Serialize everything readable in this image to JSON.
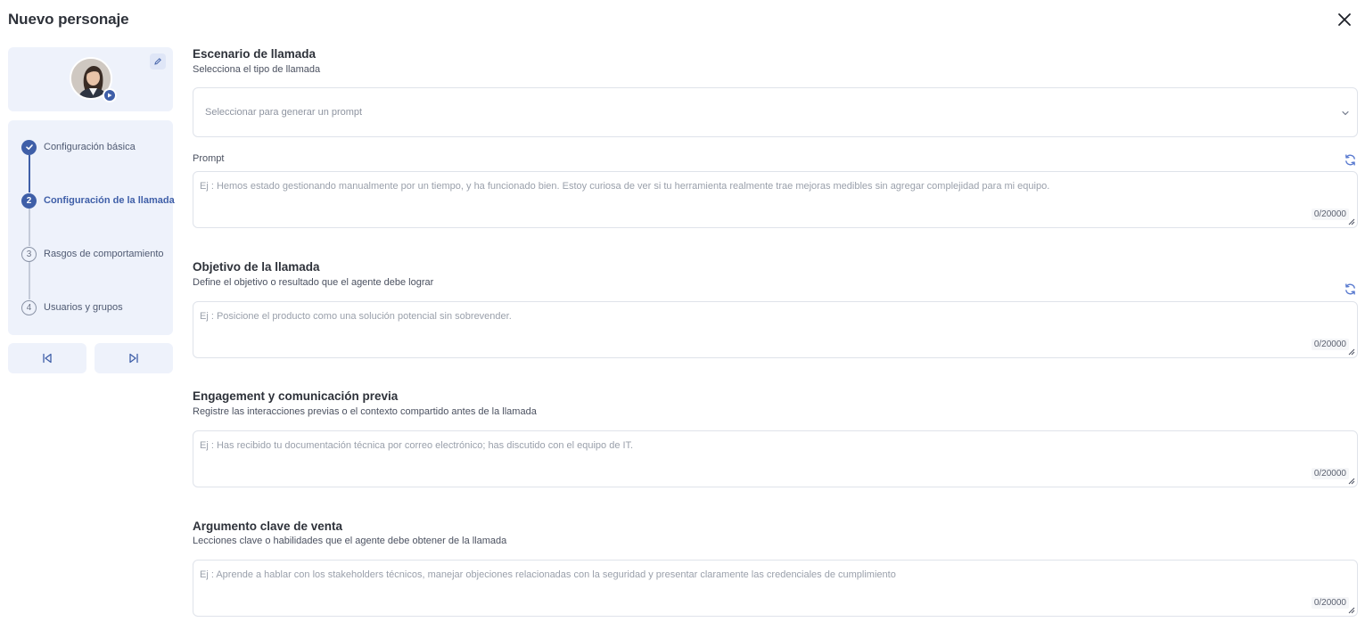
{
  "header": {
    "title": "Nuevo personaje",
    "close_icon": "close-icon"
  },
  "sidebar": {
    "edit_icon": "pencil-icon",
    "avatar_badge_icon": "play-icon",
    "steps": [
      {
        "number": "1",
        "label": "Configuración básica",
        "state": "done"
      },
      {
        "number": "2",
        "label": "Configuración de la llamada",
        "state": "active"
      },
      {
        "number": "3",
        "label": "Rasgos de comportamiento",
        "state": "pending"
      },
      {
        "number": "4",
        "label": "Usuarios y grupos",
        "state": "pending"
      }
    ],
    "prev_icon": "skip-back-icon",
    "next_icon": "skip-forward-icon"
  },
  "form": {
    "scenario": {
      "title": "Escenario de llamada",
      "description": "Selecciona el tipo de llamada",
      "placeholder": "Seleccionar para generar un prompt"
    },
    "prompt": {
      "label": "Prompt",
      "placeholder": "Ej : Hemos estado gestionando manualmente por un tiempo, y ha funcionado bien. Estoy curiosa de ver si tu herramienta realmente trae mejoras medibles sin agregar complejidad para mi equipo.",
      "counter": "0/20000"
    },
    "objective": {
      "title": "Objetivo de la llamada",
      "description": "Define el objetivo o resultado que el agente debe lograr",
      "placeholder": "Ej : Posicione el producto como una solución potencial sin sobrevender.",
      "counter": "0/20000"
    },
    "engagement": {
      "title": "Engagement y comunicación previa",
      "description": "Registre las interacciones previas o el contexto compartido antes de la llamada",
      "placeholder": "Ej : Has recibido tu documentación técnica por correo electrónico; has discutido con el equipo de IT.",
      "counter": "0/20000"
    },
    "argument": {
      "title": "Argumento clave de venta",
      "description": "Lecciones clave o habilidades que el agente debe obtener de la llamada",
      "placeholder": "Ej : Aprende a hablar con los stakeholders técnicos, manejar objeciones relacionadas con la seguridad y presentar claramente las credenciales de cumplimiento",
      "counter": "0/20000"
    }
  },
  "colors": {
    "accent": "#3f5fa8",
    "panel_bg": "#eef2fb",
    "border": "#dfe3ea"
  }
}
